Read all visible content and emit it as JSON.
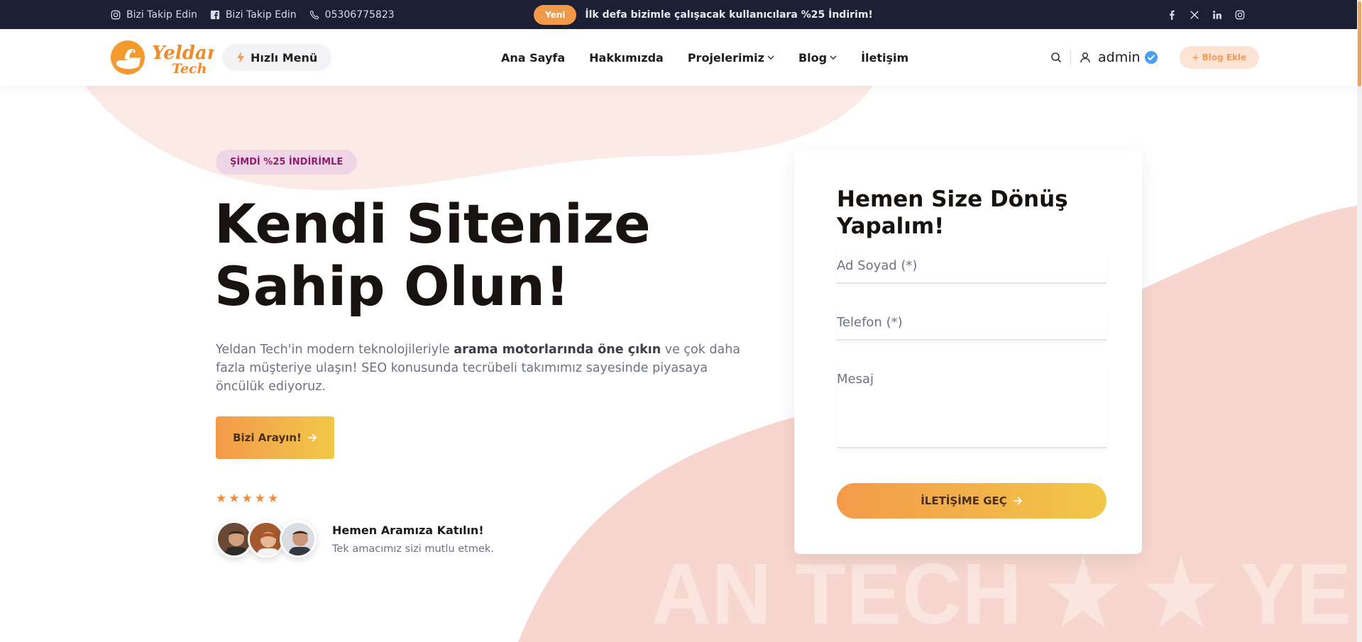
{
  "topbar": {
    "follow_1": "Bizi Takip Edin",
    "follow_2": "Bizi Takip Edin",
    "phone": "05306775823",
    "badge": "Yeni",
    "promo": "İlk defa bizimle çalışacak kullanıcılara %25 İndirim!",
    "social_icons": [
      "facebook-icon",
      "x-icon",
      "linkedin-icon",
      "instagram-icon"
    ]
  },
  "header": {
    "logo_text_1": "Yeldan",
    "logo_text_2": "Tech",
    "quick_menu": "Hızlı Menü",
    "nav": {
      "home": "Ana Sayfa",
      "about": "Hakkımızda",
      "projects": "Projelerimiz",
      "blog": "Blog",
      "contact": "İletişim"
    },
    "user": "admin",
    "blog_add": "Blog Ekle"
  },
  "hero": {
    "badge": "ŞİMDİ %25 İNDİRİMLE",
    "title": "Kendi Sitenize Sahip Olun!",
    "text_1": "Yeldan Tech'in modern teknolojileriyle ",
    "text_bold": "arama motorlarında öne çıkın",
    "text_2": " ve çok daha fazla müşteriye ulaşın! SEO konusunda tecrübeli takımımız sayesinde piyasaya öncülük ediyoruz.",
    "cta": "Bizi Arayın!",
    "rating": 5,
    "join_title": "Hemen Aramıza Katılın!",
    "join_sub": "Tek amacımız sizi mutlu etmek."
  },
  "form": {
    "title": "Hemen Size Dönüş Yapalım!",
    "name_placeholder": "Ad Soyad (*)",
    "phone_placeholder": "Telefon (*)",
    "message_placeholder": "Mesaj",
    "submit": "İLETİŞİME GEÇ"
  },
  "marquee": "AN TECH ★ ★ YELD",
  "colors": {
    "topbar_bg": "#1b2034",
    "accent_orange": "#f39a4a",
    "accent_yellow": "#f2c849",
    "blob_pink": "#f6d6cf",
    "badge_bg": "#efd6e6",
    "badge_text": "#8f1f6b"
  }
}
